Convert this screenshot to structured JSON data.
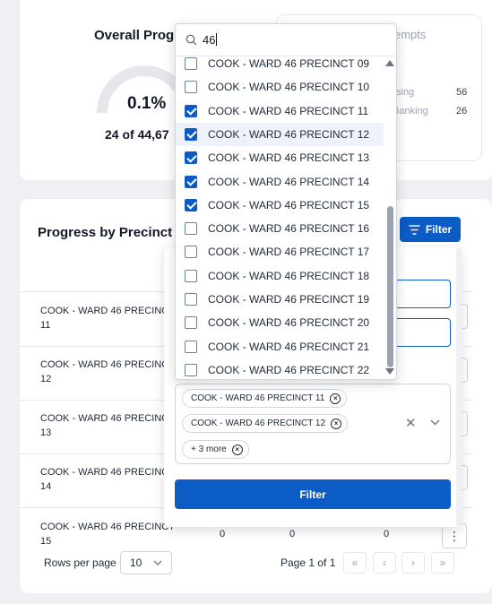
{
  "overall": {
    "title": "Overall Progr",
    "percent": "0.1%",
    "subtitle": "24 of 44,67"
  },
  "attempts": {
    "title": "empts",
    "rows": [
      {
        "label": "sing",
        "value": "56"
      },
      {
        "label": "Banking",
        "value": "26"
      }
    ]
  },
  "precinct_section": {
    "title": "Progress by Precinct",
    "filter_label": "Filter",
    "rows": [
      {
        "name_line1": "COOK - WARD 46 PRECINC",
        "name_line2": "11"
      },
      {
        "name_line1": "COOK - WARD 46 PRECINC",
        "name_line2": "12"
      },
      {
        "name_line1": "COOK - WARD 46 PRECINC",
        "name_line2": "13"
      },
      {
        "name_line1": "COOK - WARD 46 PRECINC",
        "name_line2": "14"
      },
      {
        "name_line1": "COOK - WARD 46 PRECINCT",
        "name_line2": "15",
        "v1": "0",
        "v2": "0",
        "v3": "0"
      }
    ],
    "kebab_icon": "⋮"
  },
  "pagination": {
    "rows_per_page_label": "Rows per page",
    "rows_per_page_value": "10",
    "page_info": "Page 1 of 1",
    "first": "«",
    "prev": "‹",
    "next": "›",
    "last": "»"
  },
  "filter_panel": {
    "chips": [
      "COOK - WARD 46 PRECINCT 11",
      "COOK - WARD 46 PRECINCT 12",
      "+ 3 more"
    ],
    "clear_icon": "✕",
    "chevron_icon": "⌄",
    "apply_label": "Filter"
  },
  "dropdown": {
    "search_value": "46",
    "items": [
      {
        "label": "COOK - WARD 46 PRECINCT 09",
        "checked": false
      },
      {
        "label": "COOK - WARD 46 PRECINCT 10",
        "checked": false
      },
      {
        "label": "COOK - WARD 46 PRECINCT 11",
        "checked": true
      },
      {
        "label": "COOK - WARD 46 PRECINCT 12",
        "checked": true,
        "highlighted": true
      },
      {
        "label": "COOK - WARD 46 PRECINCT 13",
        "checked": true
      },
      {
        "label": "COOK - WARD 46 PRECINCT 14",
        "checked": true
      },
      {
        "label": "COOK - WARD 46 PRECINCT 15",
        "checked": true
      },
      {
        "label": "COOK - WARD 46 PRECINCT 16",
        "checked": false
      },
      {
        "label": "COOK - WARD 46 PRECINCT 17",
        "checked": false
      },
      {
        "label": "COOK - WARD 46 PRECINCT 18",
        "checked": false
      },
      {
        "label": "COOK - WARD 46 PRECINCT 19",
        "checked": false
      },
      {
        "label": "COOK - WARD 46 PRECINCT 20",
        "checked": false
      },
      {
        "label": "COOK - WARD 46 PRECINCT 21",
        "checked": false
      },
      {
        "label": "COOK - WARD 46 PRECINCT 22",
        "checked": false
      }
    ]
  },
  "colors": {
    "accent": "#0b5cc5",
    "background": "#eef0f3"
  }
}
